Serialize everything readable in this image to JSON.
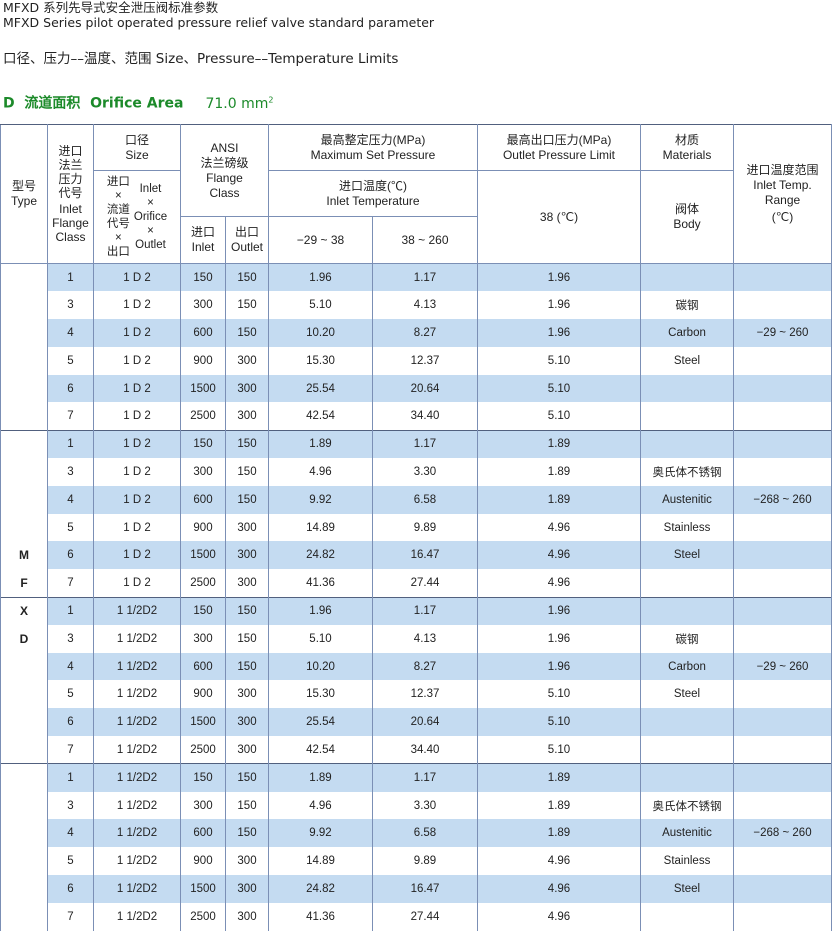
{
  "header": {
    "title_cn": "MFXD 系列先导式安全泄压阀标准参数",
    "title_en": "MFXD Series pilot operated pressure relief valve standard parameter",
    "subtitle": "口径、压力––温度、范围 Size、Pressure––Temperature Limits",
    "orifice_label": "D  流道面积  Orifice Area",
    "orifice_value": "71.0 mm",
    "orifice_unit_sup": "2"
  },
  "table": {
    "headers": {
      "type_cn": "型号",
      "type_en": "Type",
      "inlet_class_cn": "进口法兰压力代号",
      "inlet_class_en": "Inlet Flange Class",
      "size_cn": "口径",
      "size_en": "Size",
      "size_code": "进口 × Inlet 流道 × Orifice 代号 × 出口 Outlet",
      "ansi": "ANSI",
      "flange_cn": "法兰磅级",
      "flange_en": "Flange Class",
      "inlet_cn": "进口",
      "inlet_en": "Inlet",
      "outlet_cn": "出口",
      "outlet_en": "Outlet",
      "max_set_cn": "最高整定压力(MPa)",
      "max_set_en": "Maximum Set Pressure",
      "inlet_temp_cn": "进口温度(℃)",
      "inlet_temp_en": "Inlet Temperature",
      "temp_a": "−29 ~ 38",
      "temp_b": "38 ~ 260",
      "outlet_limit_cn": "最高出口压力(MPa)",
      "outlet_limit_en": "Outlet Pressure Limit",
      "outlet_temp": "38 (℃)",
      "materials_cn": "材质",
      "materials_en": "Materials",
      "body_cn": "阀体",
      "body_en": "Body",
      "inlet_range_cn": "进口温度范围",
      "inlet_range_en": "Inlet Temp. Range",
      "inlet_range_unit": "(℃)"
    },
    "type_letters": [
      "M",
      "F",
      "X",
      "D"
    ],
    "rows": [
      {
        "cls": "1",
        "size": "1 D 2",
        "inlet": "150",
        "outlet": "150",
        "p1": "1.96",
        "p2": "1.17",
        "out": "1.96",
        "mat": "",
        "temp": ""
      },
      {
        "cls": "3",
        "size": "1 D 2",
        "inlet": "300",
        "outlet": "150",
        "p1": "5.10",
        "p2": "4.13",
        "out": "1.96",
        "mat": "碳钢",
        "temp": ""
      },
      {
        "cls": "4",
        "size": "1 D 2",
        "inlet": "600",
        "outlet": "150",
        "p1": "10.20",
        "p2": "8.27",
        "out": "1.96",
        "mat": "Carbon",
        "temp": "−29 ~ 260"
      },
      {
        "cls": "5",
        "size": "1 D 2",
        "inlet": "900",
        "outlet": "300",
        "p1": "15.30",
        "p2": "12.37",
        "out": "5.10",
        "mat": "Steel",
        "temp": ""
      },
      {
        "cls": "6",
        "size": "1 D 2",
        "inlet": "1500",
        "outlet": "300",
        "p1": "25.54",
        "p2": "20.64",
        "out": "5.10",
        "mat": "",
        "temp": ""
      },
      {
        "cls": "7",
        "size": "1 D 2",
        "inlet": "2500",
        "outlet": "300",
        "p1": "42.54",
        "p2": "34.40",
        "out": "5.10",
        "mat": "",
        "temp": ""
      },
      {
        "cls": "1",
        "size": "1 D 2",
        "inlet": "150",
        "outlet": "150",
        "p1": "1.89",
        "p2": "1.17",
        "out": "1.89",
        "mat": "",
        "temp": ""
      },
      {
        "cls": "3",
        "size": "1 D 2",
        "inlet": "300",
        "outlet": "150",
        "p1": "4.96",
        "p2": "3.30",
        "out": "1.89",
        "mat": "奥氏体不锈钢",
        "temp": ""
      },
      {
        "cls": "4",
        "size": "1 D 2",
        "inlet": "600",
        "outlet": "150",
        "p1": "9.92",
        "p2": "6.58",
        "out": "1.89",
        "mat": "Austenitic",
        "temp": "−268 ~ 260"
      },
      {
        "cls": "5",
        "size": "1 D 2",
        "inlet": "900",
        "outlet": "300",
        "p1": "14.89",
        "p2": "9.89",
        "out": "4.96",
        "mat": "Stainless",
        "temp": ""
      },
      {
        "cls": "6",
        "size": "1 D 2",
        "inlet": "1500",
        "outlet": "300",
        "p1": "24.82",
        "p2": "16.47",
        "out": "4.96",
        "mat": "Steel",
        "temp": ""
      },
      {
        "cls": "7",
        "size": "1 D 2",
        "inlet": "2500",
        "outlet": "300",
        "p1": "41.36",
        "p2": "27.44",
        "out": "4.96",
        "mat": "",
        "temp": ""
      },
      {
        "cls": "1",
        "size": "1 1/2D2",
        "inlet": "150",
        "outlet": "150",
        "p1": "1.96",
        "p2": "1.17",
        "out": "1.96",
        "mat": "",
        "temp": ""
      },
      {
        "cls": "3",
        "size": "1 1/2D2",
        "inlet": "300",
        "outlet": "150",
        "p1": "5.10",
        "p2": "4.13",
        "out": "1.96",
        "mat": "碳钢",
        "temp": ""
      },
      {
        "cls": "4",
        "size": "1 1/2D2",
        "inlet": "600",
        "outlet": "150",
        "p1": "10.20",
        "p2": "8.27",
        "out": "1.96",
        "mat": "Carbon",
        "temp": "−29 ~ 260"
      },
      {
        "cls": "5",
        "size": "1 1/2D2",
        "inlet": "900",
        "outlet": "300",
        "p1": "15.30",
        "p2": "12.37",
        "out": "5.10",
        "mat": "Steel",
        "temp": ""
      },
      {
        "cls": "6",
        "size": "1 1/2D2",
        "inlet": "1500",
        "outlet": "300",
        "p1": "25.54",
        "p2": "20.64",
        "out": "5.10",
        "mat": "",
        "temp": ""
      },
      {
        "cls": "7",
        "size": "1 1/2D2",
        "inlet": "2500",
        "outlet": "300",
        "p1": "42.54",
        "p2": "34.40",
        "out": "5.10",
        "mat": "",
        "temp": ""
      },
      {
        "cls": "1",
        "size": "1 1/2D2",
        "inlet": "150",
        "outlet": "150",
        "p1": "1.89",
        "p2": "1.17",
        "out": "1.89",
        "mat": "",
        "temp": ""
      },
      {
        "cls": "3",
        "size": "1 1/2D2",
        "inlet": "300",
        "outlet": "150",
        "p1": "4.96",
        "p2": "3.30",
        "out": "1.89",
        "mat": "奥氏体不锈钢",
        "temp": ""
      },
      {
        "cls": "4",
        "size": "1 1/2D2",
        "inlet": "600",
        "outlet": "150",
        "p1": "9.92",
        "p2": "6.58",
        "out": "1.89",
        "mat": "Austenitic",
        "temp": "−268 ~ 260"
      },
      {
        "cls": "5",
        "size": "1 1/2D2",
        "inlet": "900",
        "outlet": "300",
        "p1": "14.89",
        "p2": "9.89",
        "out": "4.96",
        "mat": "Stainless",
        "temp": ""
      },
      {
        "cls": "6",
        "size": "1 1/2D2",
        "inlet": "1500",
        "outlet": "300",
        "p1": "24.82",
        "p2": "16.47",
        "out": "4.96",
        "mat": "Steel",
        "temp": ""
      },
      {
        "cls": "7",
        "size": "1 1/2D2",
        "inlet": "2500",
        "outlet": "300",
        "p1": "41.36",
        "p2": "27.44",
        "out": "4.96",
        "mat": "",
        "temp": ""
      }
    ],
    "colors": {
      "band": "#c4dbf1",
      "border": "#7b8fb5",
      "orifice": "#1c8a2a"
    }
  }
}
